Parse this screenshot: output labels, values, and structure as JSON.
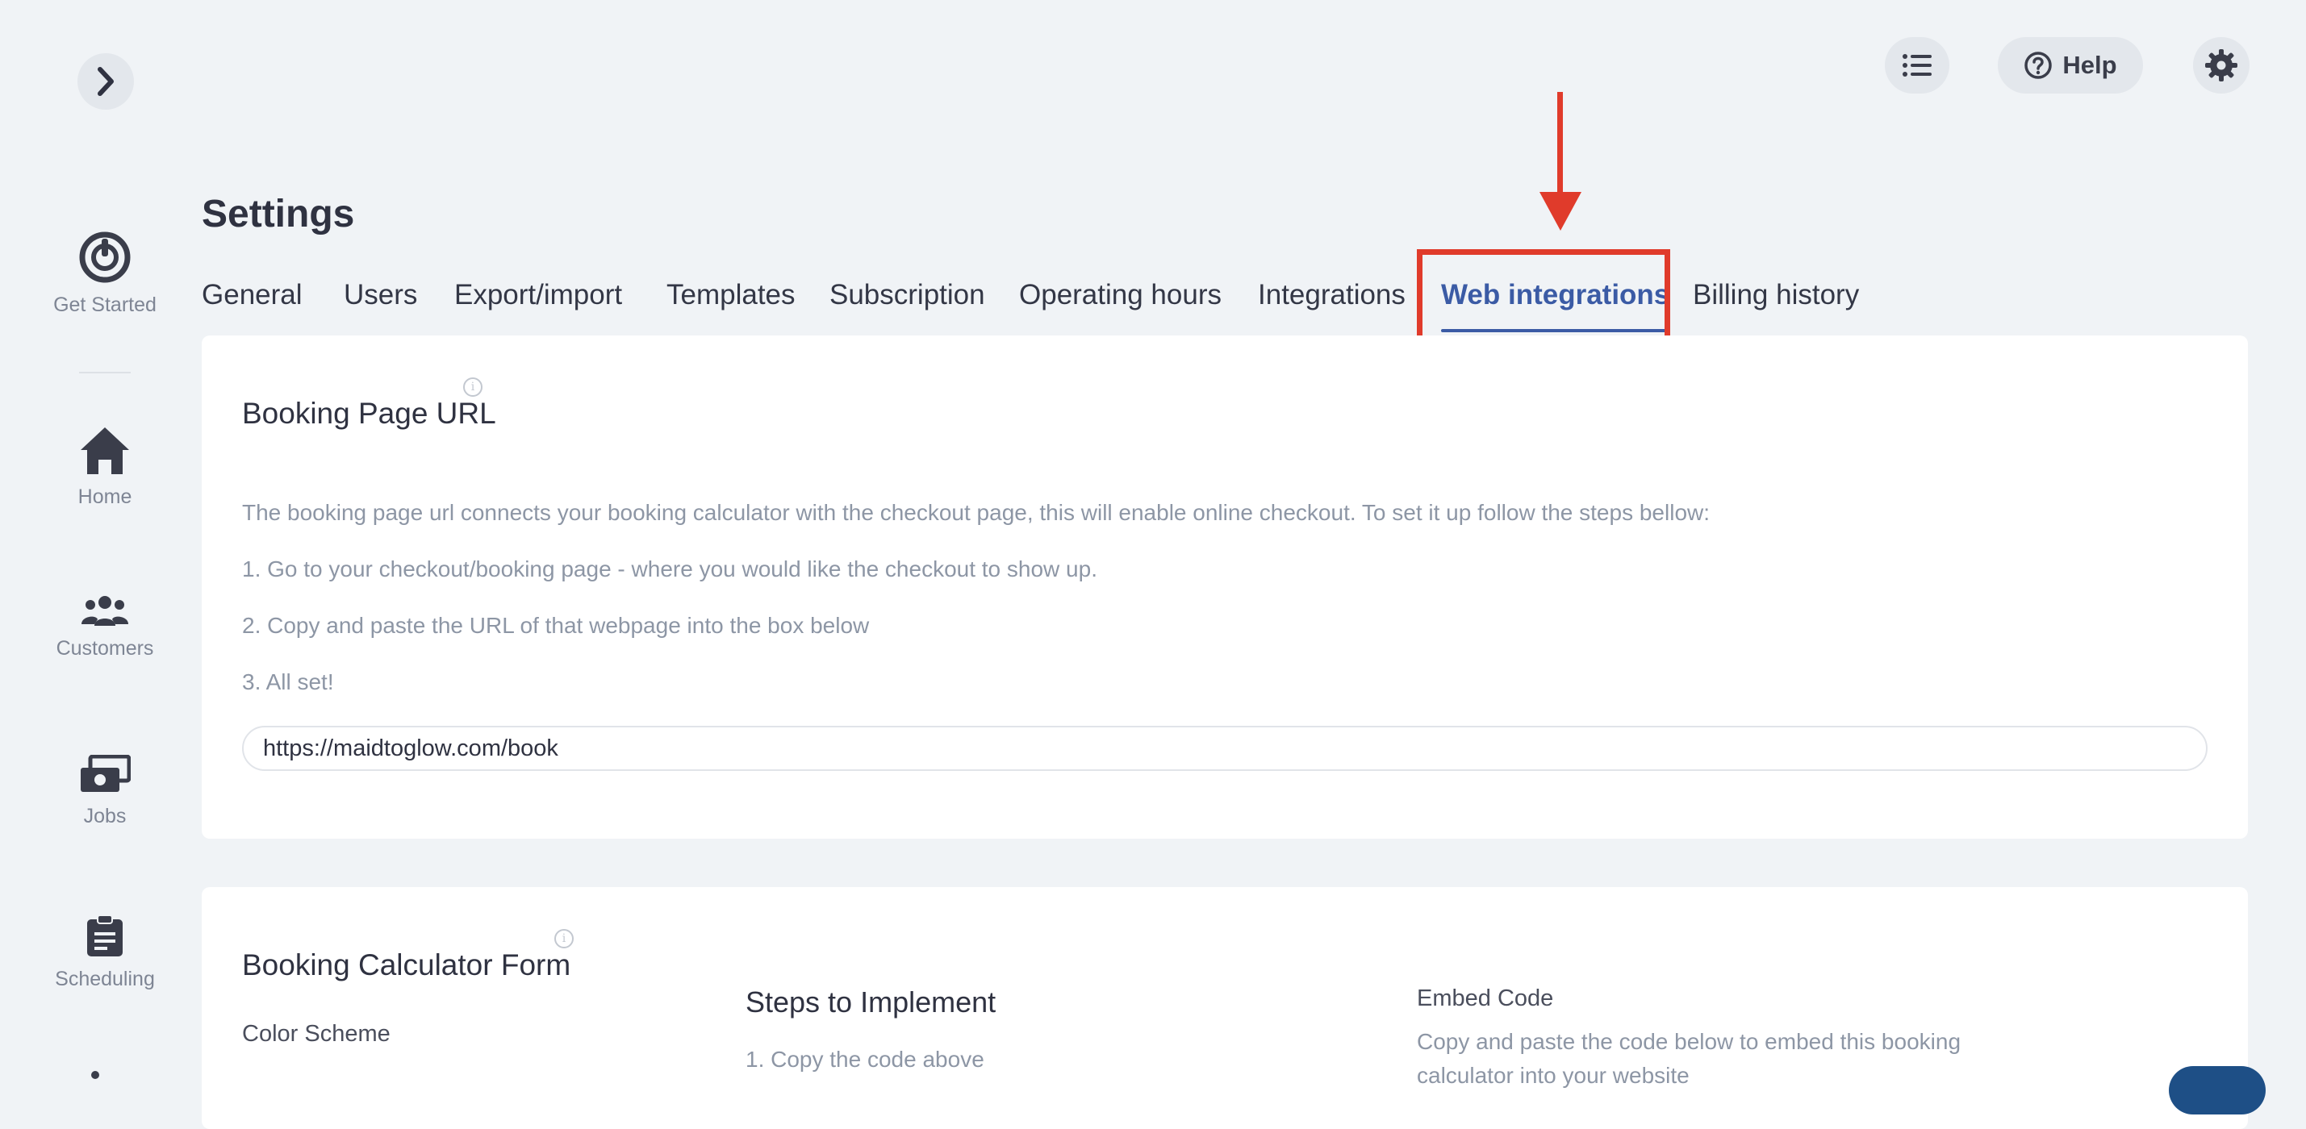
{
  "sidebar": {
    "items": [
      {
        "label": "Get Started",
        "icon": "power-icon"
      },
      {
        "label": "Home",
        "icon": "home-icon"
      },
      {
        "label": "Customers",
        "icon": "users-icon"
      },
      {
        "label": "Jobs",
        "icon": "money-icon"
      },
      {
        "label": "Scheduling",
        "icon": "clipboard-icon"
      }
    ]
  },
  "topbar": {
    "help_label": "Help"
  },
  "page": {
    "title": "Settings"
  },
  "tabs": [
    {
      "label": "General"
    },
    {
      "label": "Users"
    },
    {
      "label": "Export/import"
    },
    {
      "label": "Templates"
    },
    {
      "label": "Subscription"
    },
    {
      "label": "Operating hours"
    },
    {
      "label": "Integrations"
    },
    {
      "label": "Web integrations",
      "active": true
    },
    {
      "label": "Billing history"
    }
  ],
  "booking_url": {
    "title": "Booking Page URL",
    "description": "The booking page url connects your booking calculator with the checkout page, this will enable online checkout. To set it up follow the steps bellow:",
    "steps": [
      "1. Go to your checkout/booking page - where you would like the checkout to show up.",
      "2. Copy and paste the URL of that webpage into the box below",
      "3. All set!"
    ],
    "url_value": "https://maidtoglow.com/book"
  },
  "calculator": {
    "title": "Booking Calculator Form",
    "color_scheme_label": "Color Scheme",
    "steps_title": "Steps to Implement",
    "step_1": "1. Copy the code above",
    "embed_title": "Embed Code",
    "embed_desc_1": "Copy and paste the code below to embed this booking",
    "embed_desc_2": "calculator into your website"
  },
  "colors": {
    "accent": "#3b5ba5",
    "annotation": "#e03b2b",
    "background": "#f0f3f6"
  }
}
